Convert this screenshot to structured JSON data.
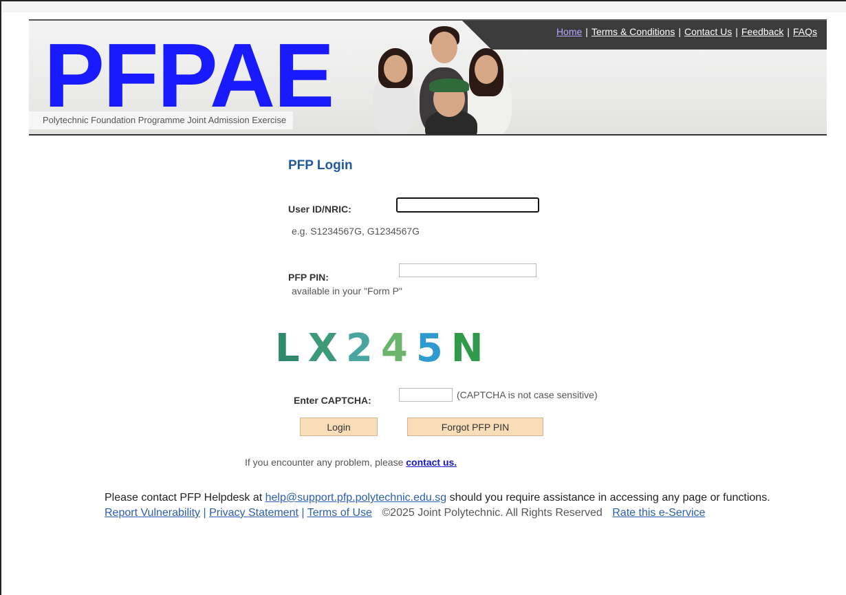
{
  "header": {
    "logo_text": "PFPAE",
    "tagline": "Polytechnic Foundation Programme Joint Admission Exercise",
    "nav": [
      {
        "label": "Home"
      },
      {
        "label": "Terms & Conditions"
      },
      {
        "label": "Contact Us"
      },
      {
        "label": "Feedback"
      },
      {
        "label": "FAQs"
      }
    ],
    "separator": "|"
  },
  "login": {
    "title": "PFP Login",
    "userid_label": "User ID/NRIC:",
    "userid_value": "",
    "userid_hint": "e.g. S1234567G, G1234567G",
    "pin_label": "PFP PIN:",
    "pin_value": "",
    "pin_hint": "available in your \"Form P\"",
    "captcha_text": [
      "L",
      "X",
      "2",
      "4",
      "5",
      "N"
    ],
    "captcha_label": "Enter CAPTCHA:",
    "captcha_value": "",
    "captcha_note": "(CAPTCHA is not case sensitive)",
    "login_button": "Login",
    "forgot_button": "Forgot PFP PIN"
  },
  "problem": {
    "text": "If you encounter any problem, please ",
    "link": "contact us."
  },
  "helpdesk": {
    "prefix": "Please contact PFP Helpdesk at ",
    "email": "help@support.pfp.polytechnic.edu.sg",
    "suffix": " should you require assistance in accessing any page or functions."
  },
  "footer": {
    "report": "Report Vulnerability",
    "privacy": "Privacy Statement",
    "terms": "Terms of Use",
    "sep": "|",
    "rights": "©2025 Joint Polytechnic. All Rights Reserved",
    "rate": "Rate this e-Service"
  },
  "colors": {
    "logo": "#1a1aff",
    "title": "#1f5a9a",
    "button_bg": "#f9dcb8",
    "link": "#2a5db0"
  }
}
